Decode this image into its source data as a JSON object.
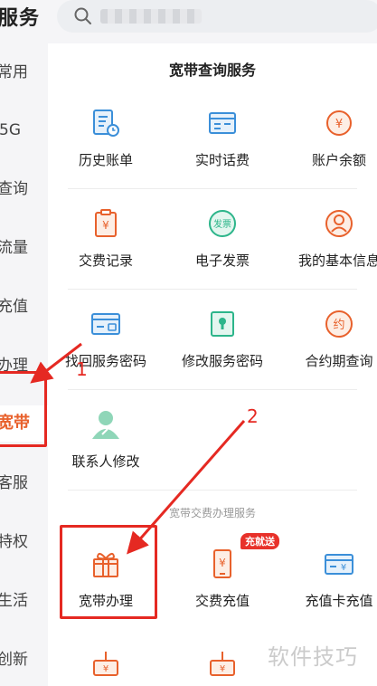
{
  "header": {
    "title": "服务",
    "search_placeholder": ""
  },
  "sidebar": {
    "items": [
      {
        "label": "常用"
      },
      {
        "label": "5G"
      },
      {
        "label": "查询"
      },
      {
        "label": "流量"
      },
      {
        "label": "充值"
      },
      {
        "label": "办理"
      },
      {
        "label": "宽带",
        "active": true
      },
      {
        "label": "客服"
      },
      {
        "label": "特权"
      },
      {
        "label": "生活"
      },
      {
        "label": "创新"
      }
    ]
  },
  "broadband_query": {
    "title": "宽带查询服务",
    "items": [
      {
        "label": "历史账单",
        "icon": "bill-history-icon"
      },
      {
        "label": "实时话费",
        "icon": "realtime-fee-icon"
      },
      {
        "label": "账户余额",
        "icon": "balance-icon"
      },
      {
        "label": "交费记录",
        "icon": "payment-record-icon"
      },
      {
        "label": "电子发票",
        "icon": "e-invoice-icon",
        "icon_text": "发票"
      },
      {
        "label": "我的基本信息",
        "icon": "profile-icon"
      },
      {
        "label": "找回服务密码",
        "icon": "recover-password-icon"
      },
      {
        "label": "修改服务密码",
        "icon": "change-password-icon"
      },
      {
        "label": "合约期查询",
        "icon": "contract-icon",
        "icon_text": "约"
      },
      {
        "label": "联系人修改",
        "icon": "contact-edit-icon"
      }
    ]
  },
  "broadband_payment": {
    "title": "宽带交费办理服务",
    "items": [
      {
        "label": "宽带办理",
        "icon": "gift-icon"
      },
      {
        "label": "交费充值",
        "icon": "phone-recharge-icon",
        "badge": "充就送"
      },
      {
        "label": "充值卡充值",
        "icon": "recharge-card-icon"
      }
    ]
  },
  "annotations": {
    "step1": "1",
    "step2": "2"
  },
  "watermark": "软件技巧",
  "colors": {
    "accent": "#e8612c",
    "highlight": "#e52922",
    "icon_blue": "#3b8fd9",
    "icon_green": "#2cb58a"
  }
}
